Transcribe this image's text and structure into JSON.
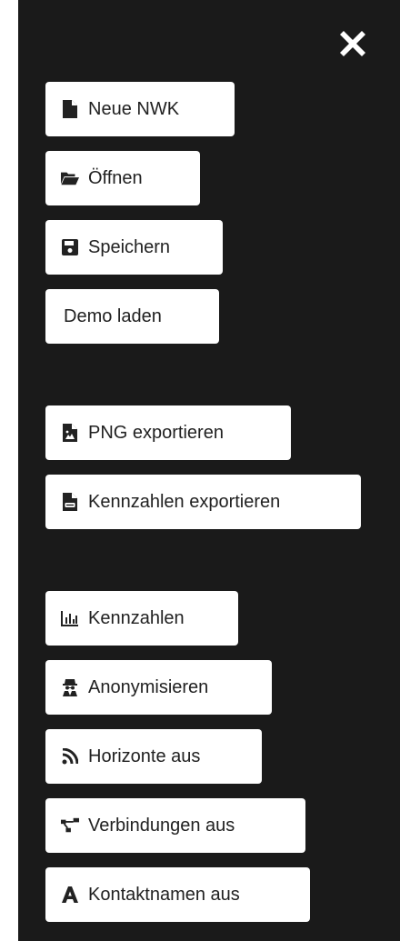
{
  "menu": {
    "close_icon": "close-icon",
    "file_items": [
      {
        "label": "Neue NWK",
        "icon": "file-icon"
      },
      {
        "label": "Öffnen",
        "icon": "folder-open-icon"
      },
      {
        "label": "Speichern",
        "icon": "save-icon"
      },
      {
        "label": "Demo laden"
      }
    ],
    "export_items": [
      {
        "label": "PNG exportieren",
        "icon": "image-file-icon"
      },
      {
        "label": "Kennzahlen exportieren",
        "icon": "csv-file-icon"
      }
    ],
    "view_items": [
      {
        "label": "Kennzahlen",
        "icon": "bar-chart-icon"
      },
      {
        "label": "Anonymisieren",
        "icon": "user-secret-icon"
      },
      {
        "label": "Horizonte aus",
        "icon": "rss-icon"
      },
      {
        "label": "Verbindungen aus",
        "icon": "network-icon"
      },
      {
        "label": "Kontaktnamen aus",
        "icon": "font-icon"
      }
    ]
  }
}
